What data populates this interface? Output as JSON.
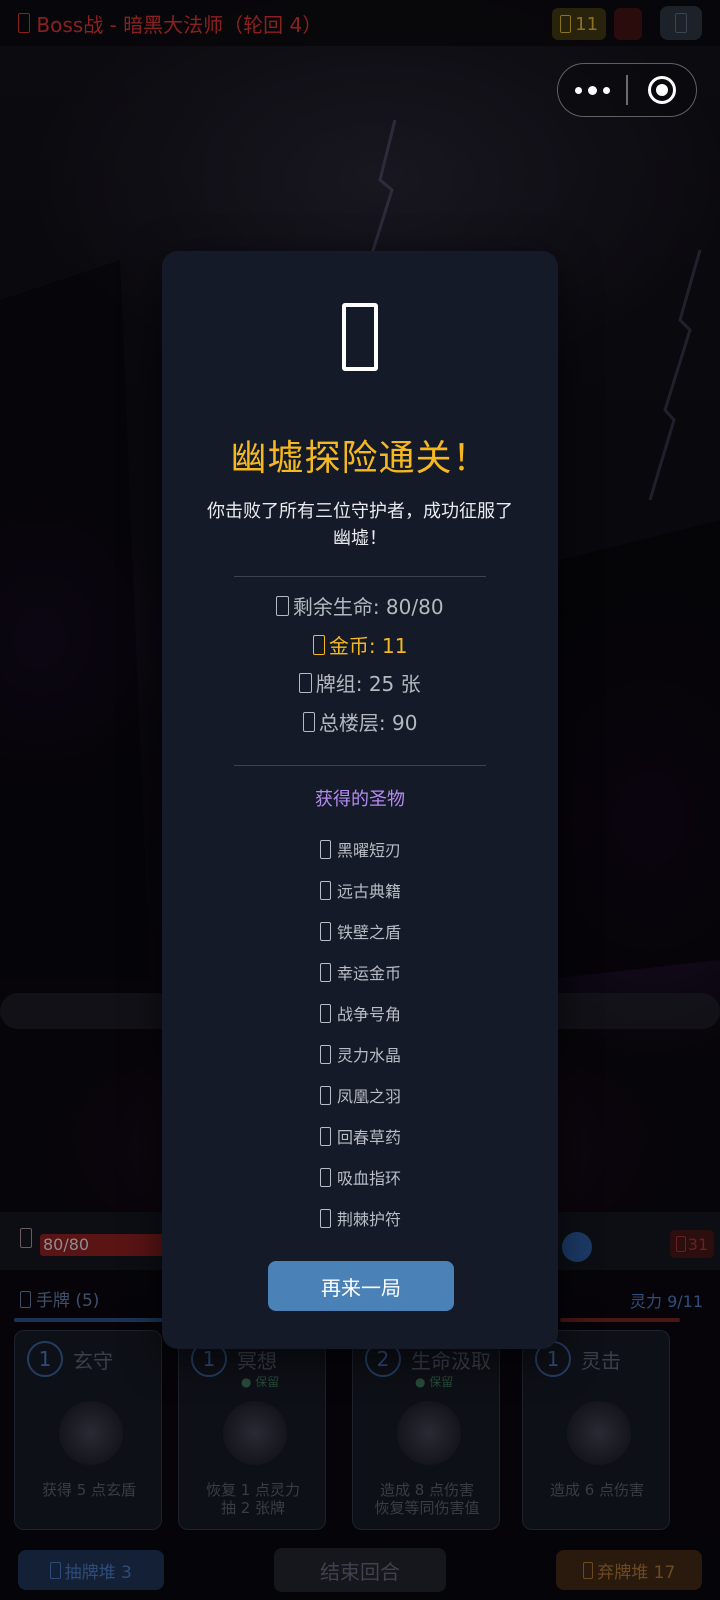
{
  "topbar": {
    "title": "Boss战 - 暗黑大法师（轮回 4）",
    "title_icon": "skull-icon",
    "gold": "11",
    "gold_icon": "coin-icon",
    "menu_icon": "settings-icon"
  },
  "battle": {
    "player_hp": "80/80",
    "enemy_hp": "31",
    "hand_label": "手牌 (5)",
    "mana_label": "灵力 9/11",
    "cards": [
      {
        "cost": "1",
        "name": "玄守",
        "tag": "",
        "desc": "获得 5 点玄盾"
      },
      {
        "cost": "1",
        "name": "冥想",
        "tag": "● 保留",
        "desc": "恢复 1 点灵力\n抽 2 张牌"
      },
      {
        "cost": "2",
        "name": "生命汲取",
        "tag": "● 保留",
        "desc": "造成 8 点伤害\n恢复等同伤害值"
      },
      {
        "cost": "1",
        "name": "灵击",
        "tag": "",
        "desc": "造成 6 点伤害"
      }
    ],
    "draw_pile": "抽牌堆 3",
    "end_turn": "结束回合",
    "discard_pile": "弃牌堆 17"
  },
  "modal": {
    "icon": "trophy-icon",
    "title": "幽墟探险通关！",
    "subtitle": "你击败了所有三位守护者，成功征服了幽墟！",
    "stats": {
      "hp": "剩余生命: 80/80",
      "gold": "金币: 11",
      "deck": "牌组: 25 张",
      "floors": "总楼层: 90"
    },
    "relics_title": "获得的圣物",
    "relics": [
      "黑曜短刃",
      "远古典籍",
      "铁壁之盾",
      "幸运金币",
      "战争号角",
      "灵力水晶",
      "凤凰之羽",
      "回春草药",
      "吸血指环",
      "荆棘护符"
    ],
    "again_button": "再来一局"
  },
  "colors": {
    "modal_bg": "#141a27",
    "title_gold": "#f5b820",
    "relic_purple": "#b48cf0",
    "button_blue": "#4a82b8"
  }
}
